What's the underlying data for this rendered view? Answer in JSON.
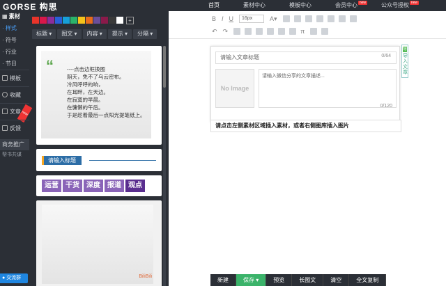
{
  "app": {
    "logo": "GORSE 构思"
  },
  "topnav": [
    {
      "label": "首页",
      "active": true,
      "badge": ""
    },
    {
      "label": "素材中心",
      "active": false,
      "badge": ""
    },
    {
      "label": "模板中心",
      "active": false,
      "badge": ""
    },
    {
      "label": "会员中心",
      "active": false,
      "badge": "new"
    },
    {
      "label": "公众号授权",
      "active": false,
      "badge": "new"
    }
  ],
  "leftnav": {
    "header": "素材",
    "subitems": [
      {
        "label": "样式",
        "active": true
      },
      {
        "label": "符号",
        "active": false
      },
      {
        "label": "行业",
        "active": false
      },
      {
        "label": "节日",
        "active": false
      }
    ],
    "groups": [
      {
        "label": "模板",
        "icon": "template-icon",
        "ribbon": ""
      },
      {
        "label": "收藏",
        "icon": "heart-icon",
        "ribbon": ""
      },
      {
        "label": "文章",
        "icon": "document-icon",
        "ribbon": "new"
      },
      {
        "label": "反馈",
        "icon": "feedback-icon",
        "ribbon": ""
      }
    ],
    "promo": "商务推广",
    "promo_sub": "帮书共谋",
    "qq": "交流群"
  },
  "swatches": [
    "#e8342a",
    "#d9174a",
    "#8c2d9a",
    "#2a5fd8",
    "#16a0d9",
    "#2ab36a",
    "#f5c21a",
    "#e86c1a",
    "#6a4e9a",
    "#8a1a4a",
    "#3a3a3a",
    "#ffffff"
  ],
  "filters": [
    "标题",
    "图文",
    "内容",
    "提示",
    "分隔"
  ],
  "material": {
    "quote_poem": "----点击边框换图\n阴天，免不了乌云密布。\n冷风呼呼的响，\n在耳畔，在天边。\n在寂寞的早晨。\n在慵懒的午后。\n于是趁着最后一点阳光提笔纸上。",
    "title_card": "请输入标题",
    "tags": [
      "运营",
      "干货",
      "深度",
      "报道",
      "观点"
    ],
    "watermark": "BiliBili"
  },
  "toolbar": {
    "font_size": "16px"
  },
  "article": {
    "title_placeholder": "请输入文章标题",
    "title_count": "0/64",
    "no_image": "No Image",
    "desc_placeholder": "请输入微信分享的文章描述...",
    "desc_count": "0/120",
    "import_badge": "导",
    "import_label": "导入文章",
    "hint": "请点击左侧素材区域插入素材，或者右侧图库插入图片"
  },
  "actions": [
    {
      "label": "新建",
      "name": "new-button"
    },
    {
      "label": "保存 ▾",
      "name": "save-button"
    },
    {
      "label": "预览",
      "name": "preview-button"
    },
    {
      "label": "长图文",
      "name": "long-image-button"
    },
    {
      "label": "清空",
      "name": "clear-button"
    },
    {
      "label": "全文复制",
      "name": "copy-all-button"
    }
  ]
}
